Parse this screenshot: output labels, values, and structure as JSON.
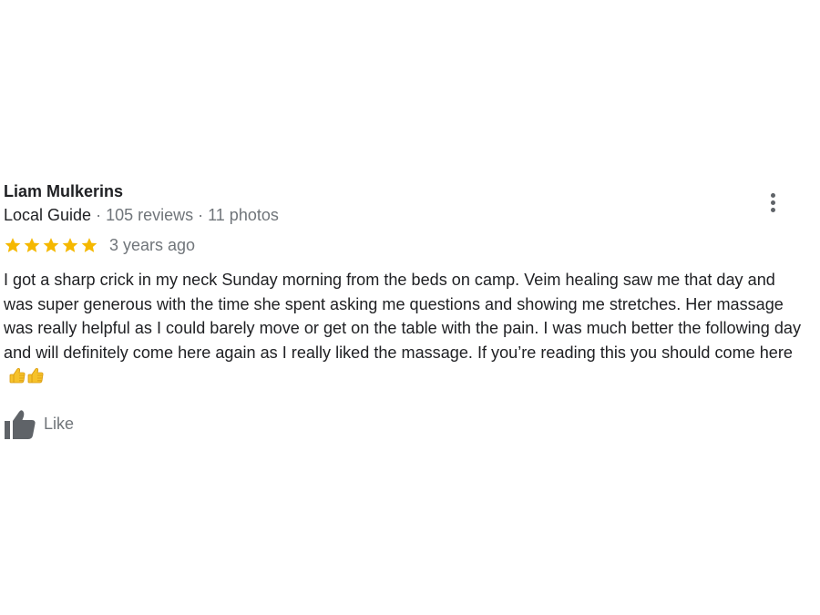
{
  "review": {
    "author_name": "Liam Mulkerins",
    "guide_label": "Local Guide",
    "separator": "·",
    "reviews_count": "105 reviews",
    "photos_count": "11 photos",
    "rating": 5,
    "rating_max": 5,
    "time_ago": "3 years ago",
    "text": "I got a sharp crick in my neck Sunday morning from the beds on camp. Veim healing saw me that day and was super generous with the time she spent asking me questions and showing me stretches. Her massage was really helpful as I could barely move or get on the table with the pain. I was much better the following day and will definitely come here again as I really liked the massage. If you’re reading this you should come here",
    "emojis": [
      "thumbs-up-emoji",
      "thumbs-up-emoji"
    ],
    "like_label": "Like"
  },
  "icons": {
    "more": "more-vertical-icon",
    "star": "star-icon",
    "like": "thumbs-up-icon"
  },
  "colors": {
    "star": "#f5b800",
    "secondary_text": "#70757a",
    "primary_text": "#202124",
    "icon": "#5f6368"
  }
}
